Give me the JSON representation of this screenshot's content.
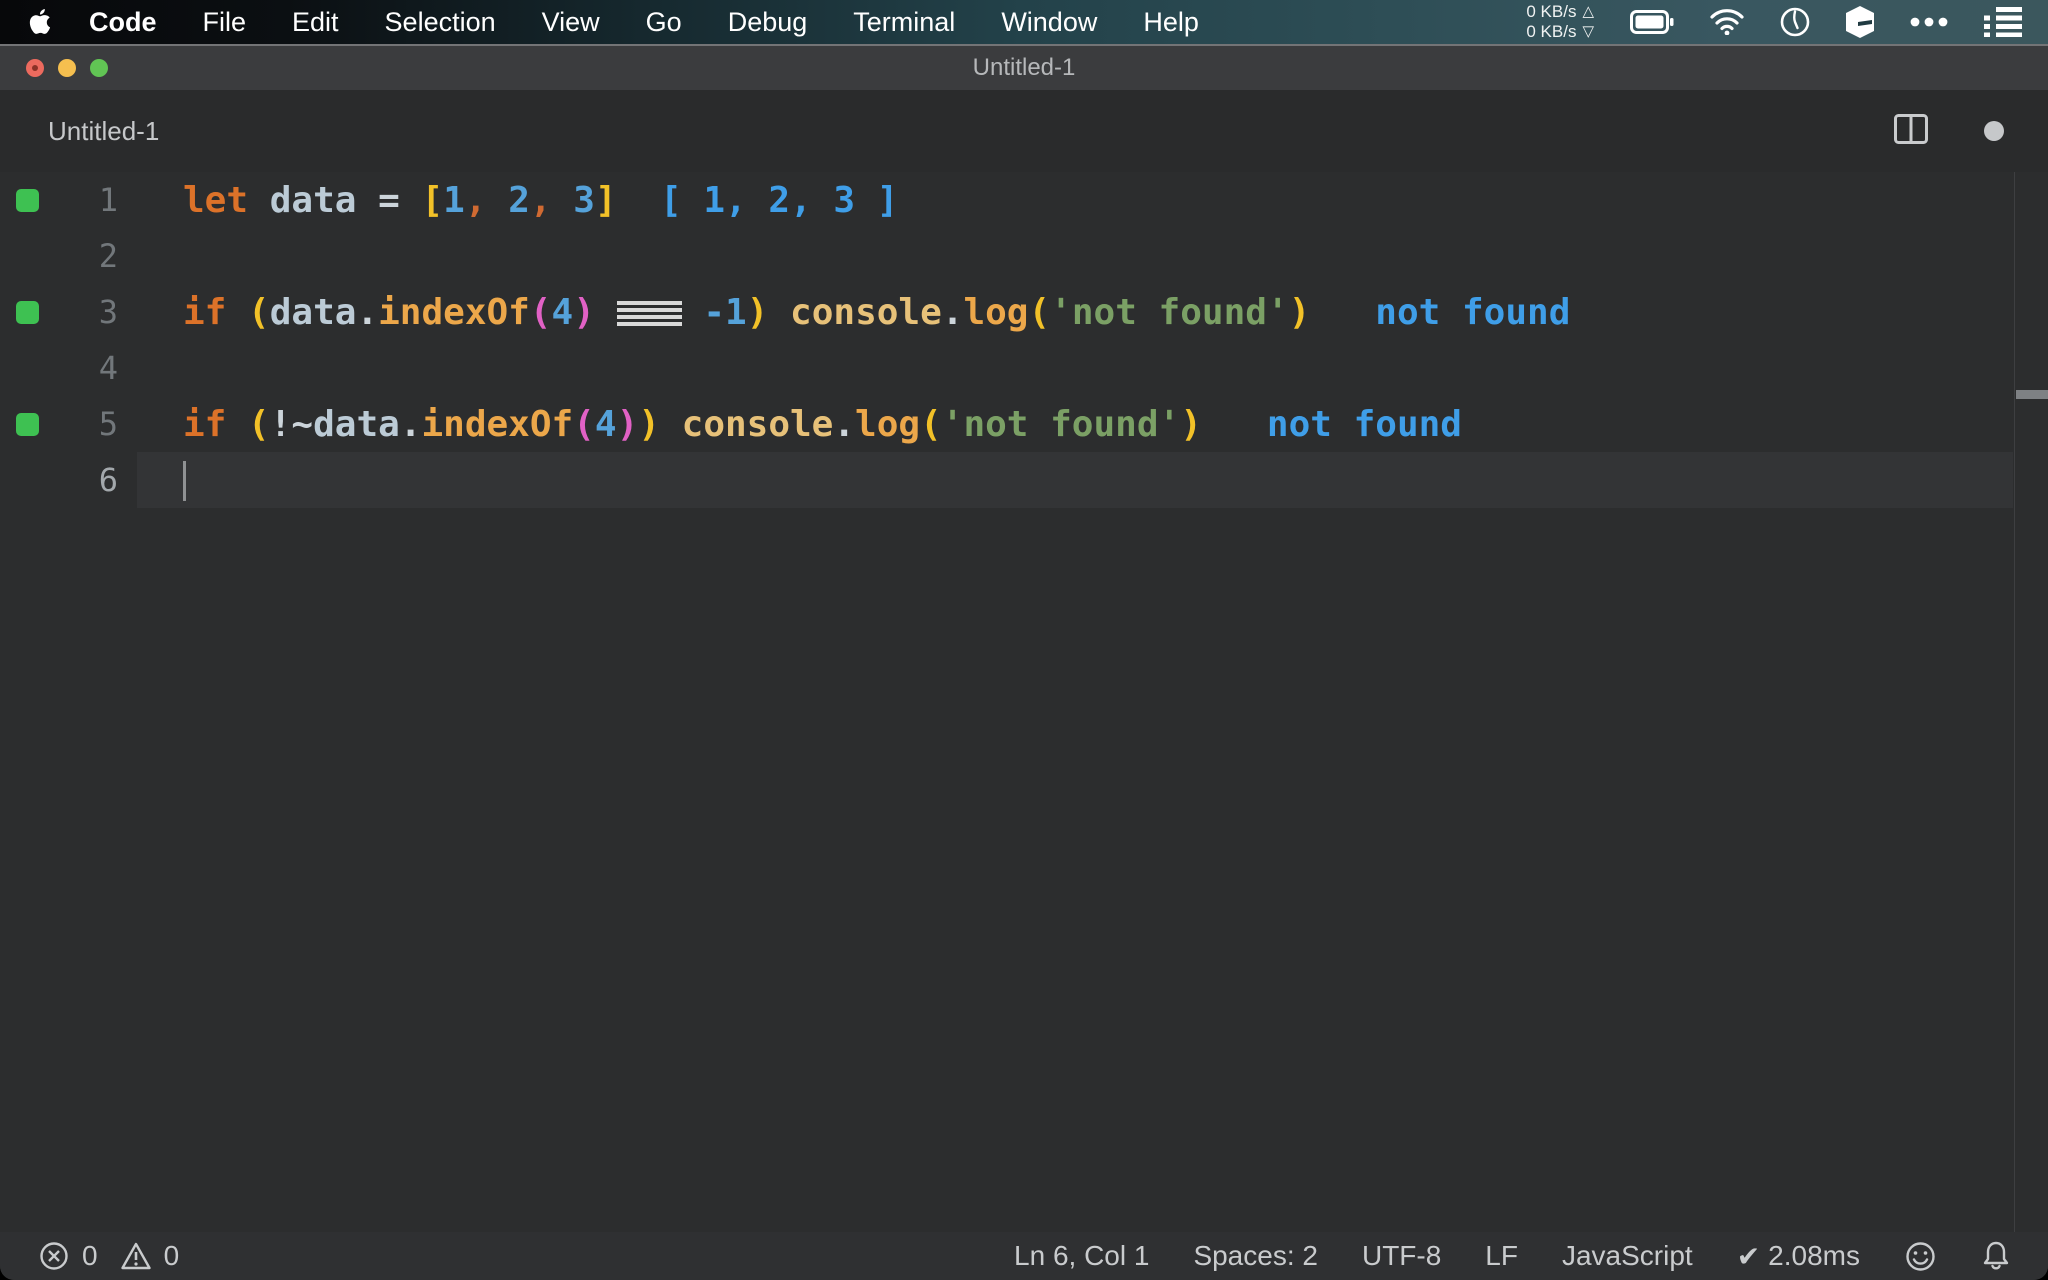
{
  "menu_bar": {
    "items": [
      {
        "label": "Code",
        "bold": true
      },
      {
        "label": "File"
      },
      {
        "label": "Edit"
      },
      {
        "label": "Selection"
      },
      {
        "label": "View"
      },
      {
        "label": "Go"
      },
      {
        "label": "Debug"
      },
      {
        "label": "Terminal"
      },
      {
        "label": "Window"
      },
      {
        "label": "Help"
      }
    ],
    "network": {
      "up": "0 KB/s",
      "up_arrow": "△",
      "down": "0 KB/s",
      "down_arrow": "▽"
    },
    "tray_icons": [
      "apple-icon",
      "battery-icon",
      "wifi-icon",
      "clock-icon",
      "cube-icon",
      "more-dots-icon",
      "list-icon"
    ]
  },
  "window": {
    "title": "Untitled-1",
    "tab": {
      "label": "Untitled-1",
      "dirty": true
    }
  },
  "editor": {
    "language": "javascript",
    "lines": [
      {
        "num": "1",
        "marker": true,
        "tokens": [
          {
            "s": "kw",
            "t": "let"
          },
          {
            "s": "txt",
            "t": " "
          },
          {
            "s": "var",
            "t": "data"
          },
          {
            "s": "txt",
            "t": " "
          },
          {
            "s": "op",
            "t": "="
          },
          {
            "s": "txt",
            "t": " "
          },
          {
            "s": "b1",
            "t": "["
          },
          {
            "s": "num",
            "t": "1"
          },
          {
            "s": "comma",
            "t": ","
          },
          {
            "s": "txt",
            "t": " "
          },
          {
            "s": "num",
            "t": "2"
          },
          {
            "s": "comma",
            "t": ","
          },
          {
            "s": "txt",
            "t": " "
          },
          {
            "s": "num",
            "t": "3"
          },
          {
            "s": "b1",
            "t": "]"
          },
          {
            "s": "res",
            "t": "  [ 1, 2, 3 ]"
          }
        ]
      },
      {
        "num": "2",
        "tokens": []
      },
      {
        "num": "3",
        "marker": true,
        "tokens": [
          {
            "s": "kw",
            "t": "if"
          },
          {
            "s": "txt",
            "t": " "
          },
          {
            "s": "b1",
            "t": "("
          },
          {
            "s": "var",
            "t": "data"
          },
          {
            "s": "op",
            "t": "."
          },
          {
            "s": "fn",
            "t": "indexOf"
          },
          {
            "s": "b2",
            "t": "("
          },
          {
            "s": "num",
            "t": "4"
          },
          {
            "s": "b2",
            "t": ")"
          },
          {
            "s": "txt",
            "t": " "
          },
          {
            "s": "lig",
            "t": "==="
          },
          {
            "s": "txt",
            "t": " "
          },
          {
            "s": "num",
            "t": "-1"
          },
          {
            "s": "b1",
            "t": ")"
          },
          {
            "s": "txt",
            "t": " "
          },
          {
            "s": "obj",
            "t": "console"
          },
          {
            "s": "op",
            "t": "."
          },
          {
            "s": "fn",
            "t": "log"
          },
          {
            "s": "b1",
            "t": "("
          },
          {
            "s": "str",
            "t": "'not found'"
          },
          {
            "s": "b1",
            "t": ")"
          },
          {
            "s": "res",
            "t": "   not found"
          }
        ]
      },
      {
        "num": "4",
        "tokens": []
      },
      {
        "num": "5",
        "marker": true,
        "tokens": [
          {
            "s": "kw",
            "t": "if"
          },
          {
            "s": "txt",
            "t": " "
          },
          {
            "s": "b1",
            "t": "("
          },
          {
            "s": "op",
            "t": "!~"
          },
          {
            "s": "var",
            "t": "data"
          },
          {
            "s": "op",
            "t": "."
          },
          {
            "s": "fn",
            "t": "indexOf"
          },
          {
            "s": "b2",
            "t": "("
          },
          {
            "s": "num",
            "t": "4"
          },
          {
            "s": "b2",
            "t": ")"
          },
          {
            "s": "b1",
            "t": ")"
          },
          {
            "s": "txt",
            "t": " "
          },
          {
            "s": "obj",
            "t": "console"
          },
          {
            "s": "op",
            "t": "."
          },
          {
            "s": "fn",
            "t": "log"
          },
          {
            "s": "b1",
            "t": "("
          },
          {
            "s": "str",
            "t": "'not found'"
          },
          {
            "s": "b1",
            "t": ")"
          },
          {
            "s": "res",
            "t": "   not found"
          }
        ]
      },
      {
        "num": "6",
        "current": true,
        "cursor": true,
        "tokens": []
      }
    ]
  },
  "status_bar": {
    "errors": "0",
    "warnings": "0",
    "check_icon": "✔",
    "right_items": [
      {
        "label": "Ln 6, Col 1"
      },
      {
        "label": "Spaces: 2"
      },
      {
        "label": "UTF-8"
      },
      {
        "label": "LF"
      },
      {
        "label": "JavaScript"
      },
      {
        "label": "2.08ms",
        "check": true
      }
    ]
  },
  "colors": {
    "keyword": "#dc7229",
    "variable": "#bccbd6",
    "number": "#55a2da",
    "comma": "#d06a32",
    "bracket_level1": "#f2c128",
    "bracket_level2": "#e161c5",
    "method": "#eca74a",
    "object": "#e7c179",
    "string": "#7ba065",
    "inline_result": "#3f9ee8",
    "coverage_marker": "#3ec152",
    "editor_bg": "#2c2d2e",
    "titlebar_bg": "#3b3c3e",
    "statusbar_bg": "#2f3032"
  }
}
